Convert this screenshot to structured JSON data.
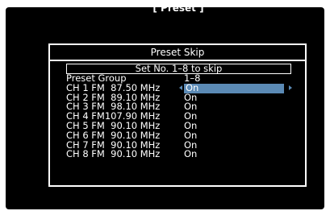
{
  "header": {
    "tab_label": "[ Preset ]"
  },
  "panel": {
    "title": "Preset Skip",
    "banner": "Set No. 1–8 to skip",
    "group_label": "Preset Group",
    "group_value": "1–8",
    "channels": [
      {
        "label": "CH 1 FM  87.50 MHz",
        "value": "On"
      },
      {
        "label": "CH 2 FM  89.10 MHz",
        "value": "On"
      },
      {
        "label": "CH 3 FM  98.10 MHz",
        "value": "On"
      },
      {
        "label": "CH 4 FM107.90 MHz",
        "value": "On"
      },
      {
        "label": "CH 5 FM  90.10 MHz",
        "value": "On"
      },
      {
        "label": "CH 6 FM  90.10 MHz",
        "value": "On"
      },
      {
        "label": "CH 7 FM  90.10 MHz",
        "value": "On"
      },
      {
        "label": "CH 8 FM  90.10 MHz",
        "value": "On"
      }
    ]
  },
  "colors": {
    "background": "#000000",
    "text": "#ffffff",
    "highlight": "#5b8ab5"
  },
  "icons": {
    "left_arrow": "arrow-left-icon",
    "right_arrow": "arrow-right-icon"
  }
}
